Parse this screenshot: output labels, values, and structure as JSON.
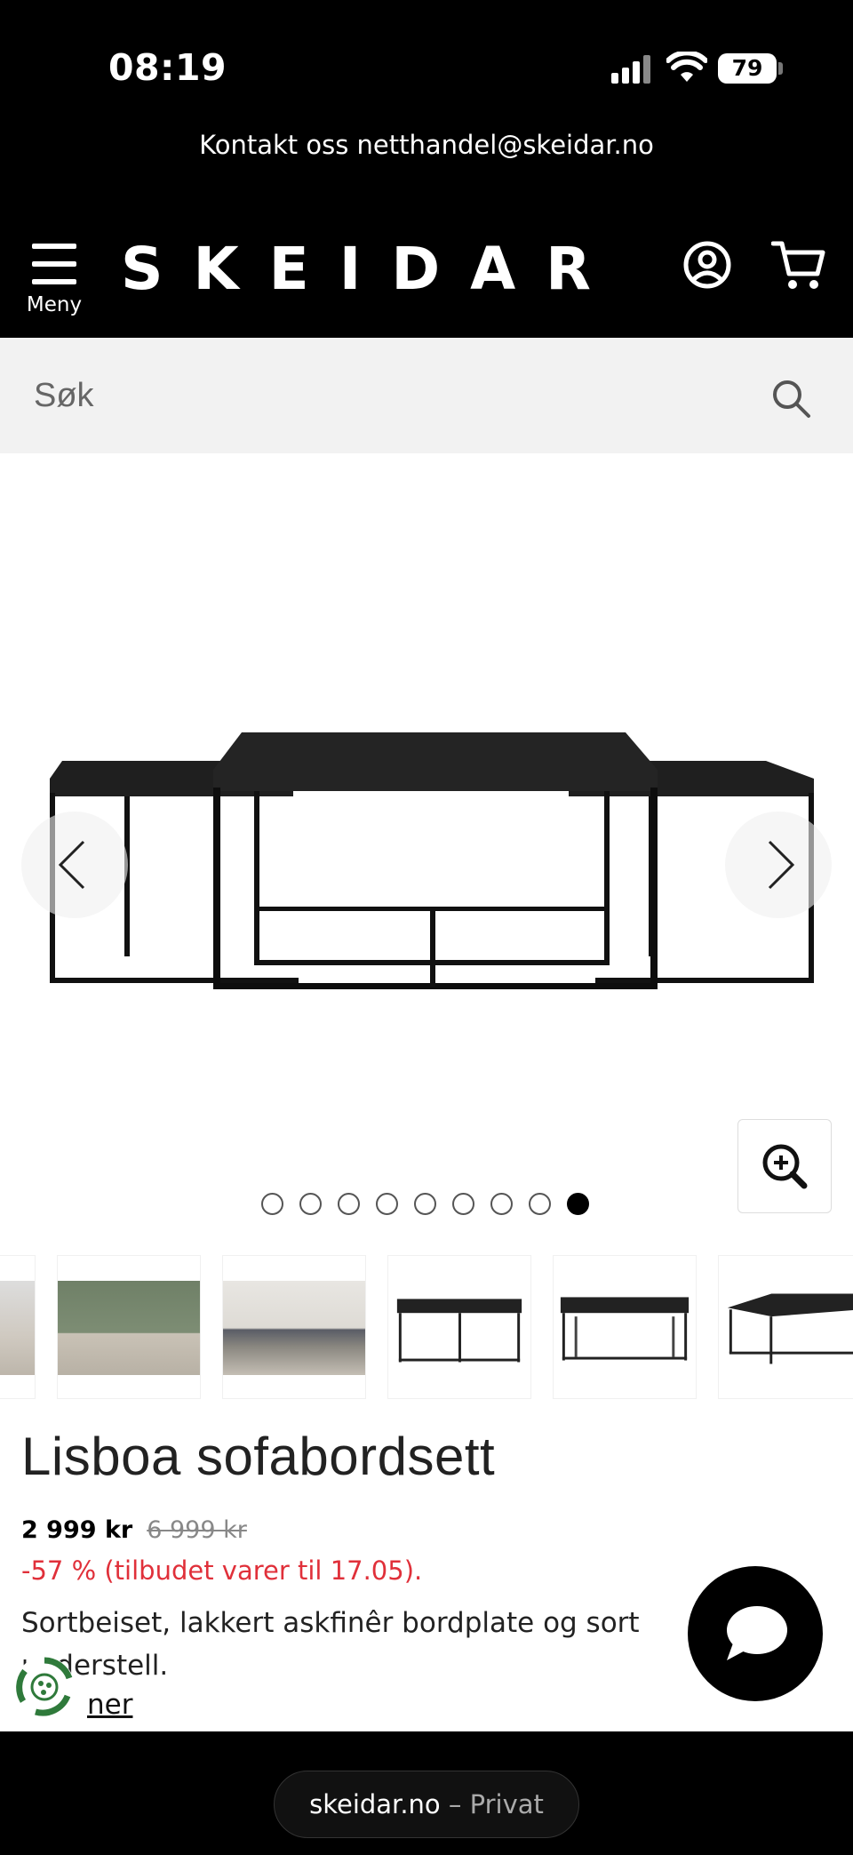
{
  "status_bar": {
    "time": "08:19",
    "battery": "79"
  },
  "contact_banner": {
    "text": "Kontakt oss netthandel@skeidar.no"
  },
  "header": {
    "menu_label": "Meny",
    "logo": "SKEIDAR"
  },
  "search": {
    "placeholder": "Søk"
  },
  "gallery": {
    "total_images": 9,
    "active_index": 9
  },
  "product": {
    "title": "Lisboa sofabordsett",
    "price": "2 999 kr",
    "old_price": "6 999 kr",
    "discount": "-57 % (tilbudet varer til 17.05).",
    "description": "Sortbeiset, lakkert askfinêr bordplate og sort understell.",
    "more_link": "ner"
  },
  "browser": {
    "domain": "skeidar.no",
    "separator": "–",
    "mode": "Privat"
  },
  "colors": {
    "accent_red": "#e0303a",
    "header_bg": "#000000",
    "search_bg": "#f2f2f2"
  }
}
